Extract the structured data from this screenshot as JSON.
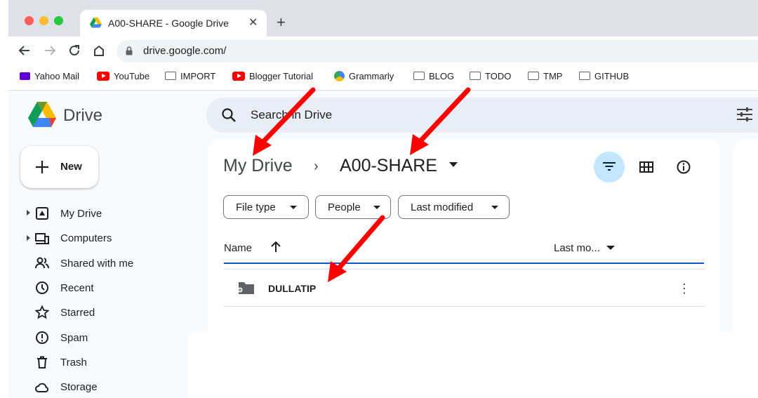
{
  "browser": {
    "tab_title": "A00-SHARE - Google Drive",
    "tab_close": "✕",
    "new_tab": "+",
    "url": "drive.google.com/",
    "bookmarks": [
      {
        "label": "Yahoo Mail",
        "icon": "yahoo-mail-icon"
      },
      {
        "label": "YouTube",
        "icon": "youtube-icon"
      },
      {
        "label": "IMPORT",
        "icon": "folder-icon"
      },
      {
        "label": "Blogger Tutorial",
        "icon": "youtube-icon"
      },
      {
        "label": "Grammarly",
        "icon": "grammarly-icon"
      },
      {
        "label": "BLOG",
        "icon": "folder-icon"
      },
      {
        "label": "TODO",
        "icon": "folder-icon"
      },
      {
        "label": "TMP",
        "icon": "folder-icon"
      },
      {
        "label": "GITHUB",
        "icon": "folder-icon"
      }
    ]
  },
  "drive": {
    "app_name": "Drive",
    "search_placeholder": "Search in Drive",
    "new_button": "New",
    "nav": [
      {
        "label": "My Drive",
        "icon": "my-drive-icon"
      },
      {
        "label": "Computers",
        "icon": "computers-icon"
      },
      {
        "label": "Shared with me",
        "icon": "people-icon"
      },
      {
        "label": "Recent",
        "icon": "clock-icon"
      },
      {
        "label": "Starred",
        "icon": "star-icon"
      },
      {
        "label": "Spam",
        "icon": "spam-icon"
      },
      {
        "label": "Trash",
        "icon": "trash-icon"
      },
      {
        "label": "Storage",
        "icon": "cloud-icon"
      }
    ],
    "breadcrumb": {
      "root": "My Drive",
      "separator": "›",
      "current": "A00-SHARE"
    },
    "filters": [
      "File type",
      "People",
      "Last modified"
    ],
    "columns": {
      "name": "Name",
      "last_modified": "Last mo..."
    },
    "rows": [
      {
        "name": "DULLATIP",
        "type": "shared-folder"
      }
    ],
    "row_more": "⋮"
  },
  "colors": {
    "accent": "#0b57d0",
    "filter_active_bg": "#c2e7ff",
    "annotation_arrow": "#ff0000"
  }
}
